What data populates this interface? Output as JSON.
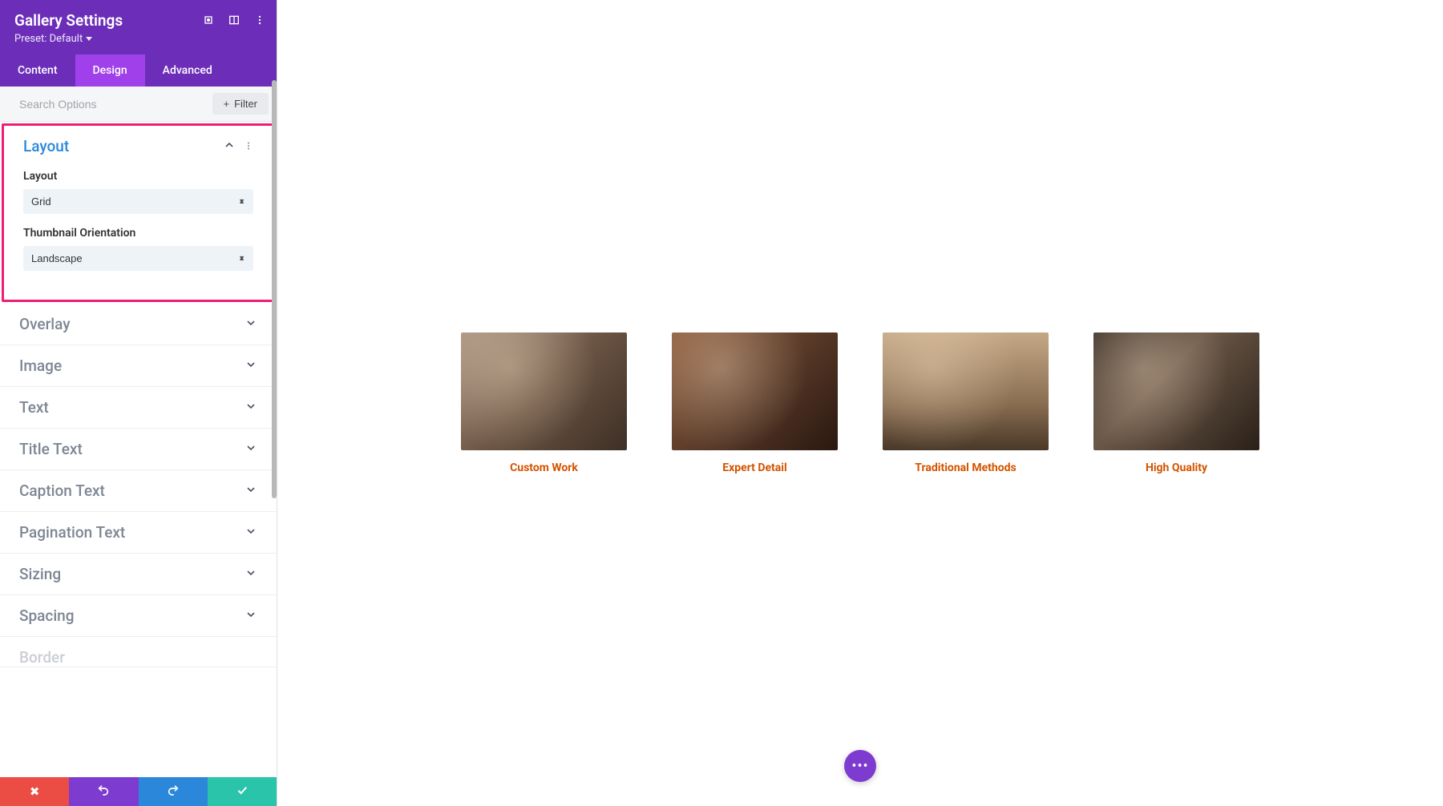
{
  "header": {
    "title": "Gallery Settings",
    "preset_label": "Preset: Default"
  },
  "tabs": {
    "content": "Content",
    "design": "Design",
    "advanced": "Advanced"
  },
  "search": {
    "placeholder": "Search Options",
    "filter_label": "Filter"
  },
  "sections": {
    "layout": {
      "title": "Layout",
      "fields": {
        "layout_label": "Layout",
        "layout_value": "Grid",
        "thumb_label": "Thumbnail Orientation",
        "thumb_value": "Landscape"
      }
    },
    "overlay": "Overlay",
    "image": "Image",
    "text": "Text",
    "title_text": "Title Text",
    "caption_text": "Caption Text",
    "pagination_text": "Pagination Text",
    "sizing": "Sizing",
    "spacing": "Spacing",
    "border": "Border"
  },
  "gallery": {
    "items": [
      {
        "caption": "Custom Work"
      },
      {
        "caption": "Expert Detail"
      },
      {
        "caption": "Traditional Methods"
      },
      {
        "caption": "High Quality"
      }
    ]
  }
}
